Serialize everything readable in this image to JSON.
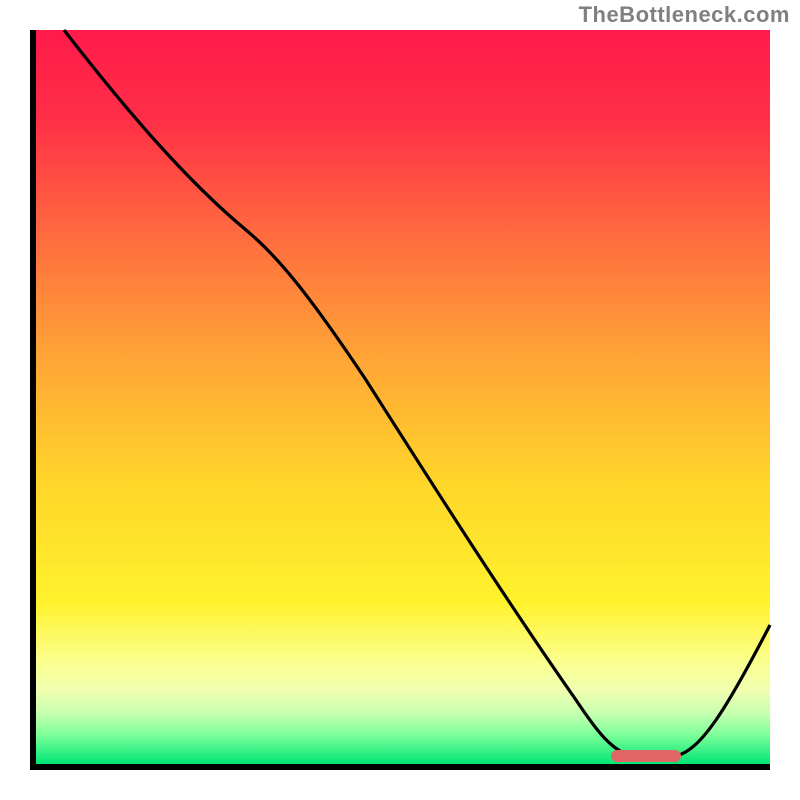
{
  "watermark": "TheBottleneck.com",
  "colors": {
    "gradient_top": "#ff1a4a",
    "gradient_mid": "#ffd62a",
    "gradient_bottom": "#00e676",
    "curve": "#000000",
    "marker": "#e06666",
    "axis": "#000000"
  },
  "chart_data": {
    "type": "line",
    "title": "",
    "xlabel": "",
    "ylabel": "",
    "xlim": [
      0,
      100
    ],
    "ylim": [
      0,
      100
    ],
    "series": [
      {
        "name": "bottleneck-curve",
        "x": [
          4,
          12,
          20,
          28,
          36,
          44,
          52,
          60,
          68,
          74,
          80,
          84,
          88,
          92,
          96,
          100
        ],
        "y": [
          100,
          89,
          79,
          72,
          63,
          52,
          40,
          28,
          16,
          8,
          2,
          0,
          0,
          4,
          12,
          20
        ]
      }
    ],
    "annotations": [
      {
        "name": "optimal-range-marker",
        "x_range": [
          78,
          88
        ],
        "y": 1,
        "color": "#e06666"
      }
    ],
    "background": {
      "type": "vertical-gradient",
      "stops": [
        {
          "pos": 0.0,
          "color": "#ff1a4a"
        },
        {
          "pos": 0.28,
          "color": "#ff6b3f"
        },
        {
          "pos": 0.62,
          "color": "#ffd62a"
        },
        {
          "pos": 0.86,
          "color": "#fbff8e"
        },
        {
          "pos": 1.0,
          "color": "#00e676"
        }
      ]
    }
  }
}
